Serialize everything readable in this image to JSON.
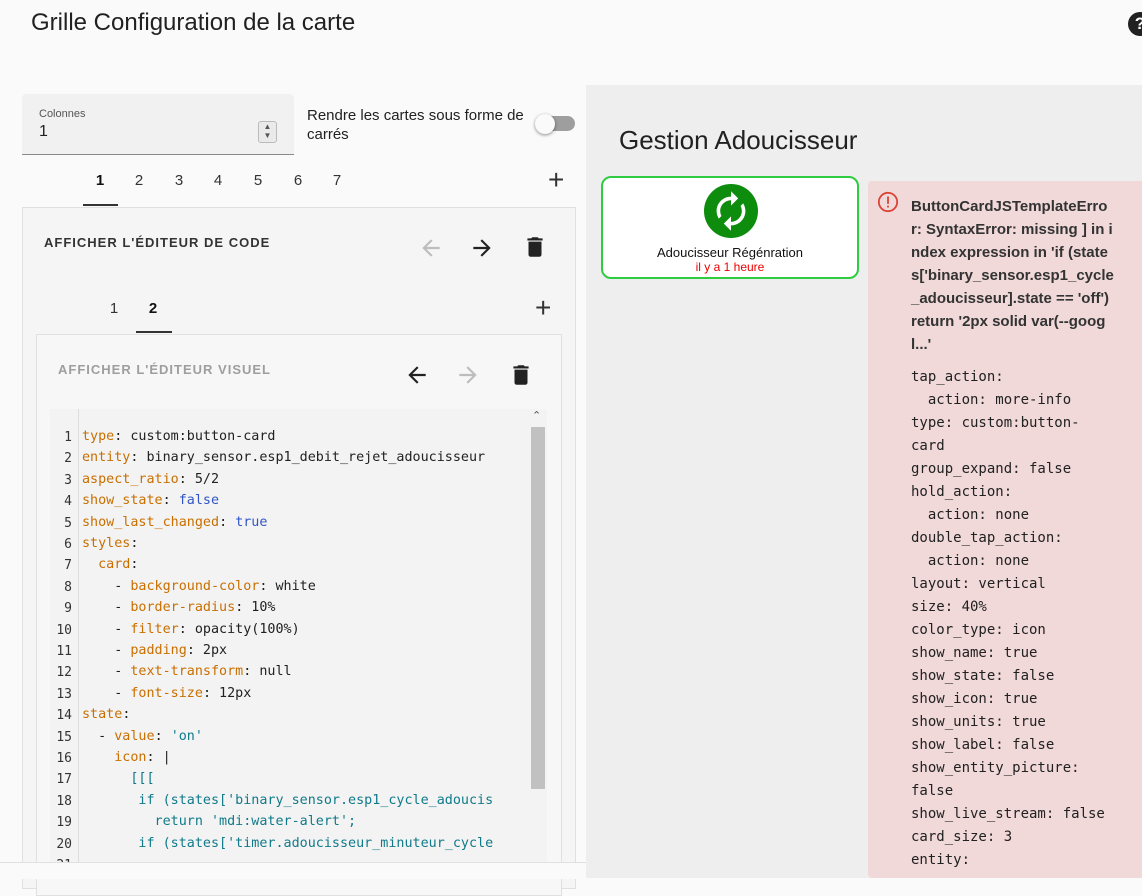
{
  "header": {
    "title": "Grille Configuration de la carte",
    "help_icon": "help-circle-icon"
  },
  "grid_options": {
    "columns_label": "Colonnes",
    "columns_value": "1",
    "square_label": "Rendre les cartes sous forme de carrés",
    "square_enabled": false
  },
  "card_tabs": [
    "1",
    "2",
    "3",
    "4",
    "5",
    "6",
    "7"
  ],
  "card_tabs_active": "1",
  "card_toolbar": {
    "toggle_label": "AFFICHER L'ÉDITEUR DE CODE"
  },
  "sub_tabs": [
    "1",
    "2"
  ],
  "sub_tabs_active": "2",
  "sub_toolbar": {
    "toggle_label": "AFFICHER L'ÉDITEUR VISUEL"
  },
  "code_lines": [
    "type: custom:button-card",
    "entity: binary_sensor.esp1_debit_rejet_adoucisseur",
    "aspect_ratio: 5/2",
    "show_state: false",
    "show_last_changed: true",
    "styles:",
    "  card:",
    "    - background-color: white",
    "    - border-radius: 10%",
    "    - filter: opacity(100%)",
    "    - padding: 2px",
    "    - text-transform: null",
    "    - font-size: 12px",
    "state:",
    "  - value: 'on'",
    "    icon: |",
    "      [[[",
    "       if (states['binary_sensor.esp1_cycle_adoucis",
    "         return 'mdi:water-alert';",
    "       if (states['timer.adoucisseur_minuteur_cycle"
  ],
  "preview": {
    "title": "Gestion Adoucisseur",
    "button_card": {
      "name": "Adoucisseur Régénration",
      "state": "il y a 1 heure",
      "icon": "sync-icon",
      "accent_color": "#0e8c0e",
      "border_color": "#2ecc40"
    },
    "error": {
      "title": "ButtonCardJSTemplateError: SyntaxError: missing ] in index expression in 'if (states['binary_sensor.esp1_cycle_adoucisseur].state == 'off') return '2px solid var(--googl...'",
      "yaml_lines": [
        "tap_action:",
        "  action: more-info",
        "type: custom:button-",
        "card",
        "group_expand: false",
        "hold_action:",
        "  action: none",
        "double_tap_action:",
        "  action: none",
        "layout: vertical",
        "size: 40%",
        "color_type: icon",
        "show_name: true",
        "show_state: false",
        "show_icon: true",
        "show_units: true",
        "show_label: false",
        "show_entity_picture:",
        "false",
        "show_live_stream: false",
        "card_size: 3",
        "entity:"
      ]
    }
  }
}
